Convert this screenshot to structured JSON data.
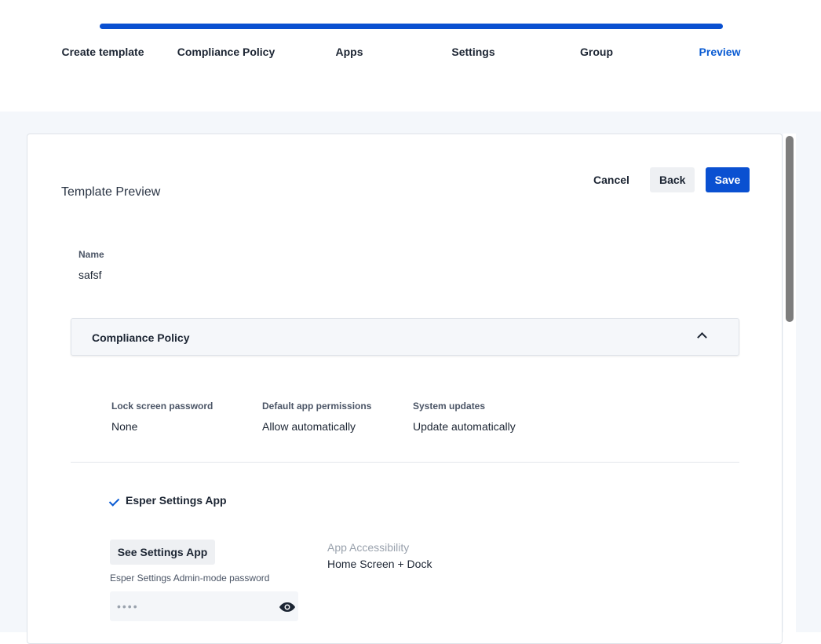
{
  "steps": [
    {
      "label": "Create template",
      "active": false
    },
    {
      "label": "Compliance Policy",
      "active": false
    },
    {
      "label": "Apps",
      "active": false
    },
    {
      "label": "Settings",
      "active": false
    },
    {
      "label": "Group",
      "active": false
    },
    {
      "label": "Preview",
      "active": true
    }
  ],
  "progress": {
    "percent": 100
  },
  "page": {
    "title": "Template Preview"
  },
  "actions": {
    "cancel": "Cancel",
    "back": "Back",
    "save": "Save"
  },
  "name_field": {
    "label": "Name",
    "value": "safsf"
  },
  "compliance": {
    "title": "Compliance Policy",
    "expanded": true,
    "fields": [
      {
        "label": "Lock screen password",
        "value": "None"
      },
      {
        "label": "Default app permissions",
        "value": "Allow automatically"
      },
      {
        "label": "System updates",
        "value": "Update automatically"
      }
    ]
  },
  "settings_app": {
    "checked_label": "Esper Settings App",
    "see_button": "See Settings App",
    "accessibility_label": "App Accessibility",
    "accessibility_value": "Home Screen + Dock",
    "password_label": "Esper Settings Admin-mode password",
    "password_value": "••••"
  },
  "colors": {
    "accent": "#0a50d1",
    "active_step": "#0a5bd3",
    "background": "#f4f7fb"
  },
  "icons": {
    "accordion": "chevron-up-icon",
    "checkmark": "check-icon",
    "password_toggle": "eye-icon"
  }
}
